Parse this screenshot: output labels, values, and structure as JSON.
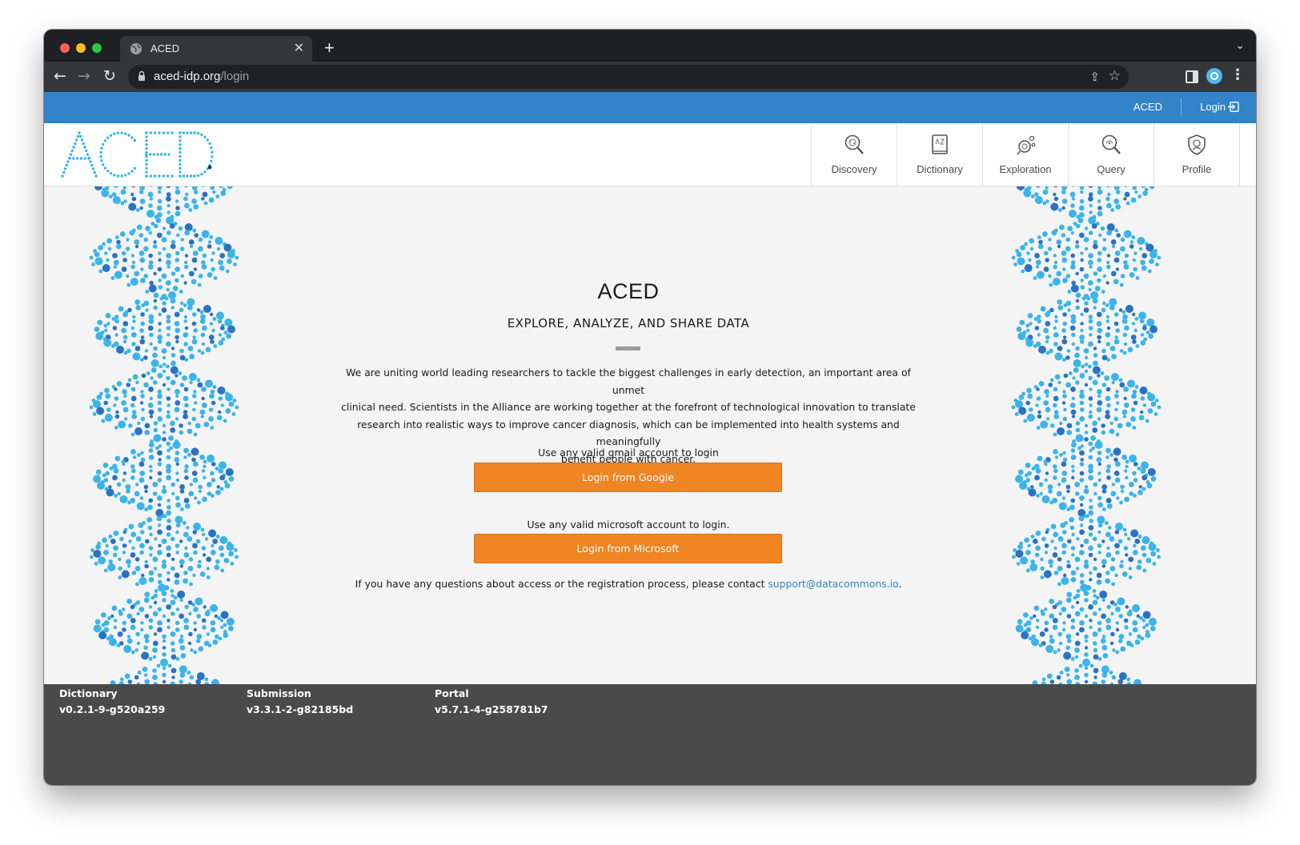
{
  "browser": {
    "tab_title": "ACED",
    "new_tab_symbol": "+",
    "url_host": "aced-idp.org",
    "url_path": "/login"
  },
  "topbar": {
    "aced_link": "ACED",
    "login_link": "Login"
  },
  "navbar": {
    "logo_text": "ACED",
    "items": [
      {
        "label": "Discovery",
        "icon": "discovery-icon"
      },
      {
        "label": "Dictionary",
        "icon": "dictionary-icon"
      },
      {
        "label": "Exploration",
        "icon": "exploration-icon"
      },
      {
        "label": "Query",
        "icon": "query-icon"
      },
      {
        "label": "Profile",
        "icon": "profile-icon"
      }
    ]
  },
  "main": {
    "title": "ACED",
    "subtitle": "EXPLORE, ANALYZE, AND SHARE DATA",
    "description_lines": [
      "We are uniting world leading researchers to tackle the biggest challenges in early detection, an important area of unmet",
      "clinical need. Scientists in the Alliance are working together at the forefront of technological innovation to translate",
      "research into realistic ways to improve cancer diagnosis, which can be implemented into health systems and meaningfully",
      "benefit people with cancer."
    ],
    "google_hint": "Use any valid gmail account to login",
    "google_button": "Login from Google",
    "microsoft_hint": "Use any valid microsoft account to login.",
    "microsoft_button": "Login from Microsoft",
    "contact_prefix": "If you have any questions about access or the registration process, please contact ",
    "contact_email": "support@datacommons.io",
    "contact_suffix": "."
  },
  "footer": {
    "columns": [
      {
        "name": "Dictionary",
        "version": "v0.2.1-9-g520a259"
      },
      {
        "name": "Submission",
        "version": "v3.3.1-2-g82185bd"
      },
      {
        "name": "Portal",
        "version": "v5.7.1-4-g258781b7"
      }
    ]
  },
  "colors": {
    "brand_blue": "#3283c8",
    "button_orange": "#ef8523",
    "footer_gray": "#4a4a4a",
    "dna_light": "#3bb4ea",
    "dna_dark": "#2a73c4"
  }
}
